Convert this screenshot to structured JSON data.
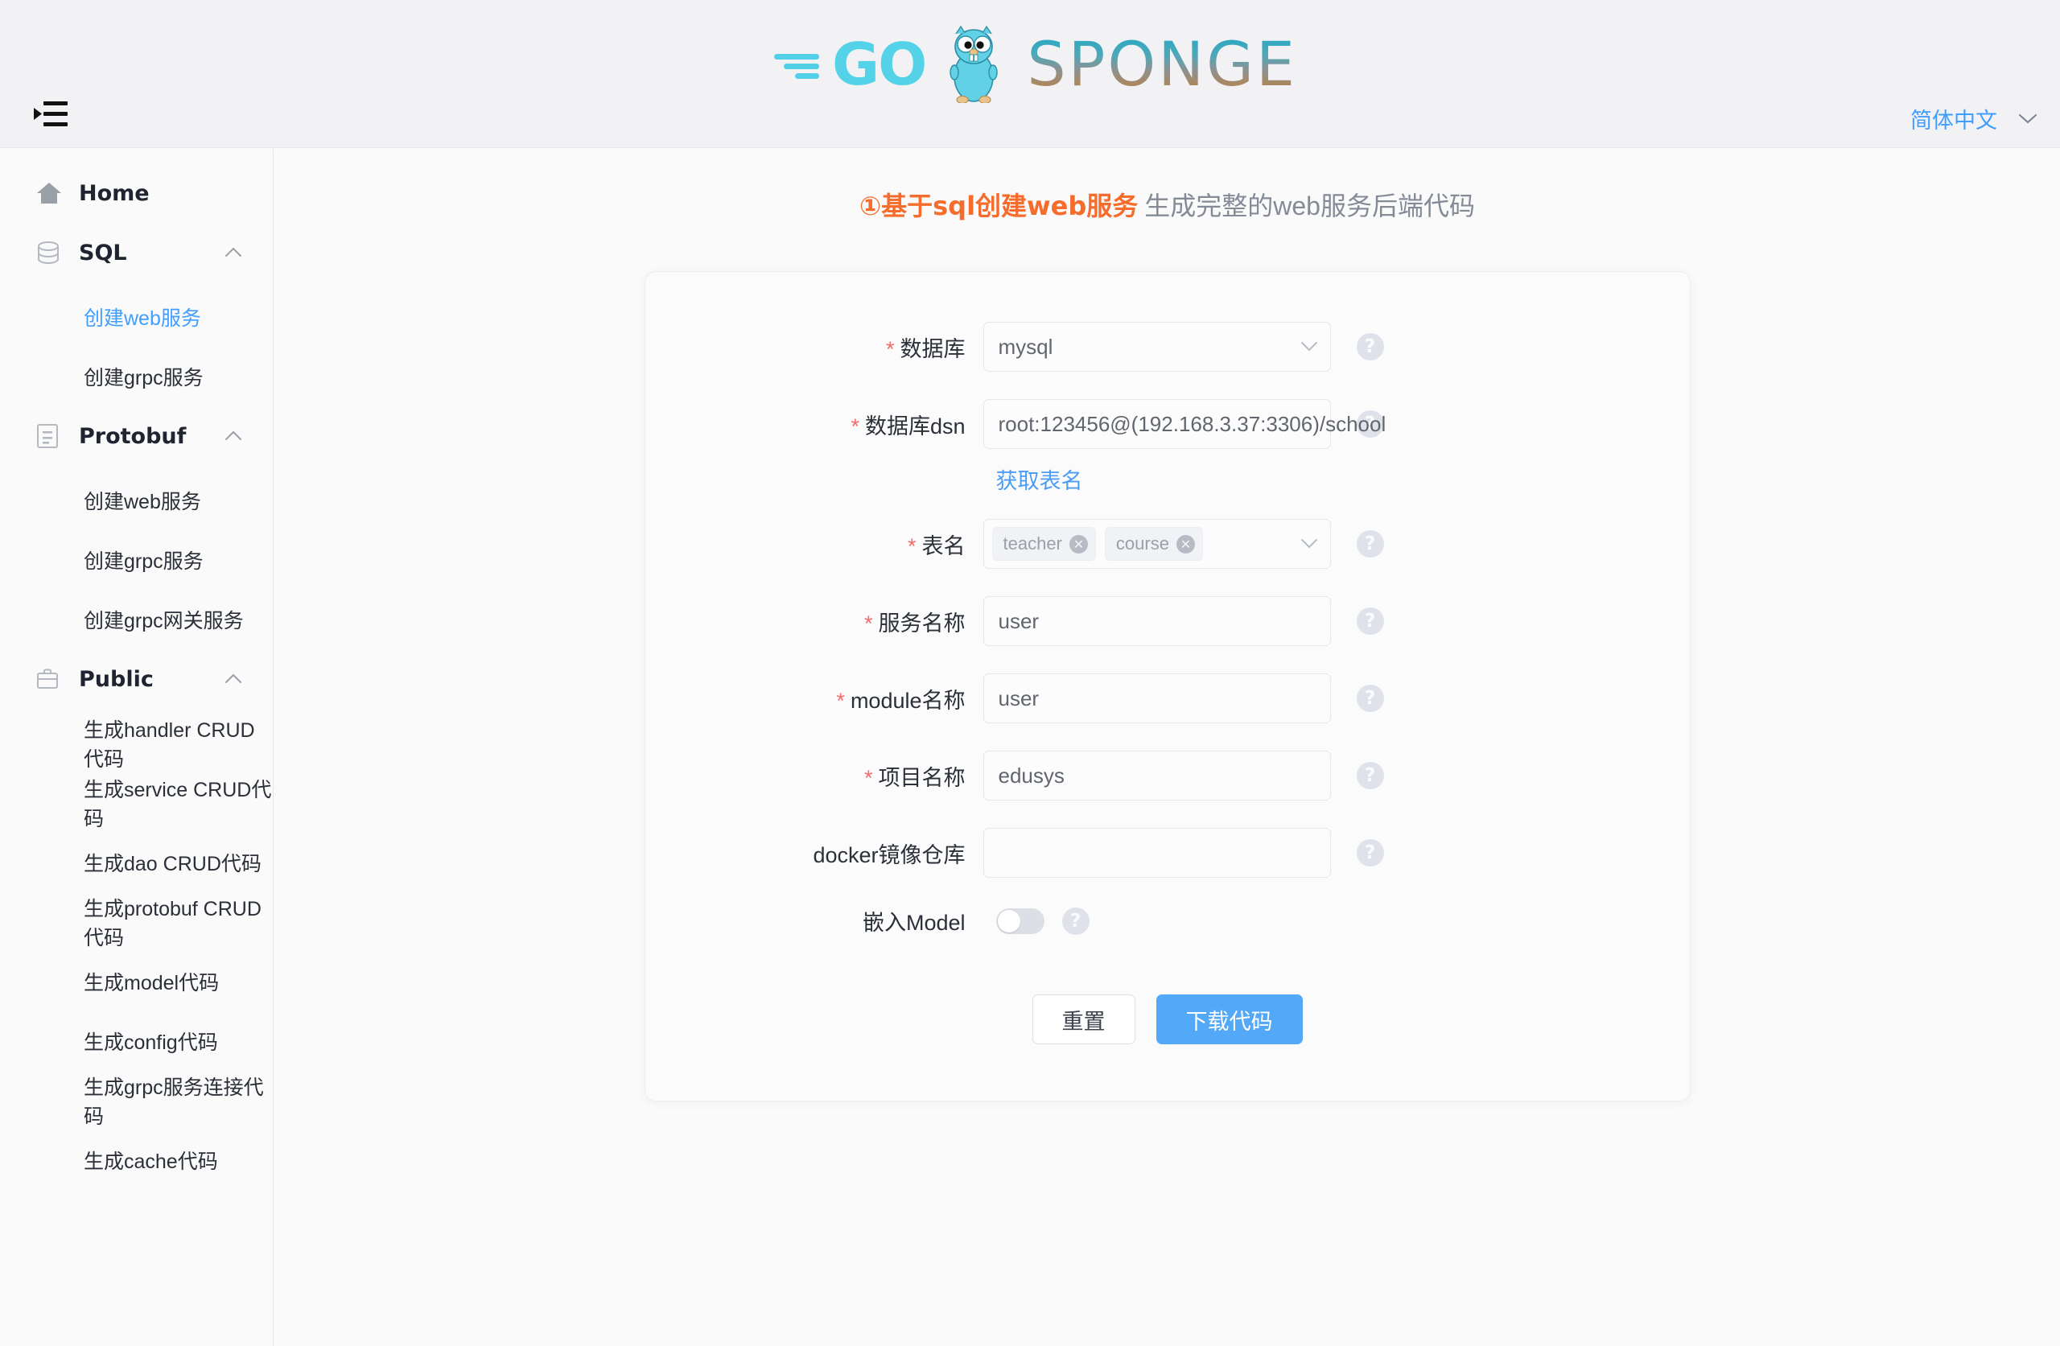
{
  "header": {
    "logo_go": "GO",
    "logo_sponge": "SPONGE",
    "menu_icon": "menu-fold-icon",
    "language": "简体中文"
  },
  "sidebar": {
    "home": {
      "label": "Home",
      "icon": "home-icon"
    },
    "groups": [
      {
        "label": "SQL",
        "icon": "database-icon",
        "items": [
          {
            "label": "创建web服务",
            "active": true
          },
          {
            "label": "创建grpc服务",
            "active": false
          }
        ]
      },
      {
        "label": "Protobuf",
        "icon": "document-icon",
        "items": [
          {
            "label": "创建web服务",
            "active": false
          },
          {
            "label": "创建grpc服务",
            "active": false
          },
          {
            "label": "创建grpc网关服务",
            "active": false
          }
        ]
      },
      {
        "label": "Public",
        "icon": "briefcase-icon",
        "items": [
          {
            "label": "生成handler CRUD代码",
            "active": false
          },
          {
            "label": "生成service CRUD代码",
            "active": false
          },
          {
            "label": "生成dao CRUD代码",
            "active": false
          },
          {
            "label": "生成protobuf CRUD代码",
            "active": false
          },
          {
            "label": "生成model代码",
            "active": false
          },
          {
            "label": "生成config代码",
            "active": false
          },
          {
            "label": "生成grpc服务连接代码",
            "active": false
          },
          {
            "label": "生成cache代码",
            "active": false
          }
        ]
      }
    ]
  },
  "main": {
    "title_strong": "①基于sql创建web服务",
    "title_sub": "生成完整的web服务后端代码",
    "form": {
      "database": {
        "label": "数据库",
        "required": true,
        "value": "mysql",
        "help": "?"
      },
      "dsn": {
        "label": "数据库dsn",
        "required": true,
        "value": "root:123456@(192.168.3.37:3306)/school",
        "help": "?"
      },
      "get_tables_link": "获取表名",
      "tables": {
        "label": "表名",
        "required": true,
        "tags": [
          "teacher",
          "course"
        ],
        "help": "?"
      },
      "service_name": {
        "label": "服务名称",
        "required": true,
        "value": "user",
        "help": "?"
      },
      "module_name": {
        "label": "module名称",
        "required": true,
        "value": "user",
        "help": "?"
      },
      "project_name": {
        "label": "项目名称",
        "required": true,
        "value": "edusys",
        "help": "?"
      },
      "docker_repo": {
        "label": "docker镜像仓库",
        "required": false,
        "value": "",
        "help": "?"
      },
      "embed_model": {
        "label": "嵌入Model",
        "enabled": false,
        "help": "?"
      }
    },
    "buttons": {
      "reset": "重置",
      "download": "下载代码"
    }
  },
  "colors": {
    "accent_blue": "#409eff",
    "primary_button": "#53a8f8",
    "title_orange": "#f56c2d",
    "required_red": "#f56c6c"
  }
}
